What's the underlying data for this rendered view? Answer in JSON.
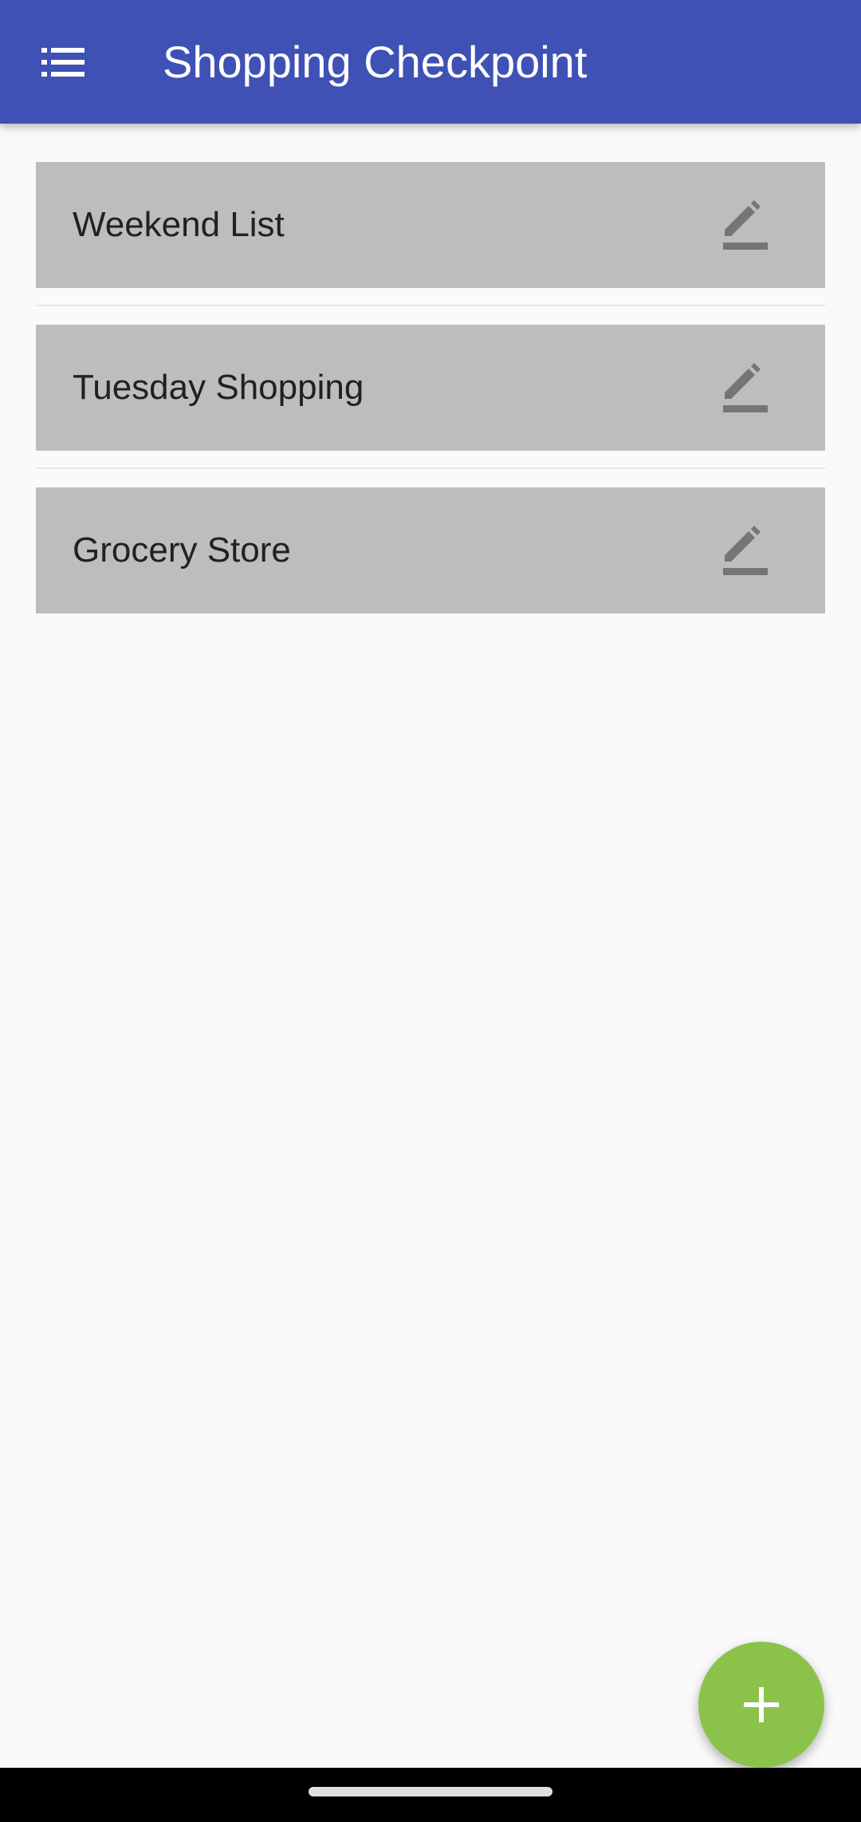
{
  "app_bar": {
    "title": "Shopping Checkpoint",
    "menu_icon": "list-icon",
    "background": "#3f51b5"
  },
  "lists": [
    {
      "label": "Weekend List",
      "icon": "edit-icon"
    },
    {
      "label": "Tuesday Shopping",
      "icon": "edit-icon"
    },
    {
      "label": "Grocery Store",
      "icon": "edit-icon"
    }
  ],
  "fab": {
    "icon": "add-icon",
    "color": "#8bc34a"
  },
  "colors": {
    "item_background": "#bdbdbd",
    "page_background": "#fafafa",
    "icon_gray": "#757575"
  }
}
